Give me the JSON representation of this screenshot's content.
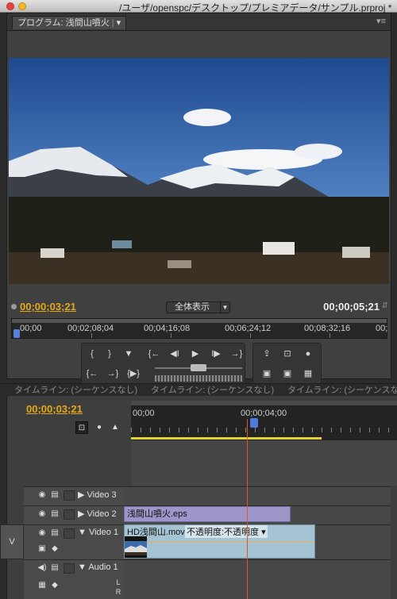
{
  "window": {
    "title": "/ユーザ/openspc/デスクトップ/プレミアデータ/サンプル.prproj *"
  },
  "program_monitor": {
    "tab_label": "プログラム: 浅間山噴火",
    "tab_menu_glyph": "▾",
    "panel_menu_glyph": "▾≡",
    "current_timecode": "00;00;03;21",
    "zoom_label": "全体表示",
    "duration_timecode": "00;00;05;21",
    "ruler_labels": [
      "00;00",
      "00;02;08;04",
      "00;04;16;08",
      "00;06;24;12",
      "00;08;32;16",
      "00;"
    ],
    "controls_row1": [
      "{",
      "}",
      "▼",
      "{←",
      "◀I",
      "▶",
      "I▶",
      "→}"
    ],
    "controls_row2": [
      "{←",
      "→}",
      "{▶}"
    ],
    "controls_right_row1": [
      "⇪",
      "⊡",
      "●"
    ],
    "controls_right_row2": [
      "▣",
      "▣",
      "▦"
    ]
  },
  "timeline_tabs": [
    "タイムライン: (シーケンスなし)",
    "タイムライン: (シーケンスなし)",
    "タイムライン: (シーケンスなし"
  ],
  "timeline": {
    "current_timecode": "00;00;03;21",
    "ruler_labels": [
      "00;00",
      "00;00;04;00"
    ],
    "tracks": [
      {
        "name": "Video 3"
      },
      {
        "name": "Video 2"
      },
      {
        "name": "Video 1"
      },
      {
        "name": "Audio 1"
      }
    ],
    "side_label": "V",
    "clips": {
      "eps_name": "浅間山噴火.eps",
      "mov_name": "HD浅間山.mov",
      "opacity_label": "不透明度:不透明度 ▾"
    },
    "audio_lr": [
      "L",
      "R"
    ]
  },
  "colors": {
    "timecode": "#e5a918",
    "playhead": "#e05522",
    "eps_clip": "#9c97c8",
    "mov_clip": "#a5c3d3"
  }
}
